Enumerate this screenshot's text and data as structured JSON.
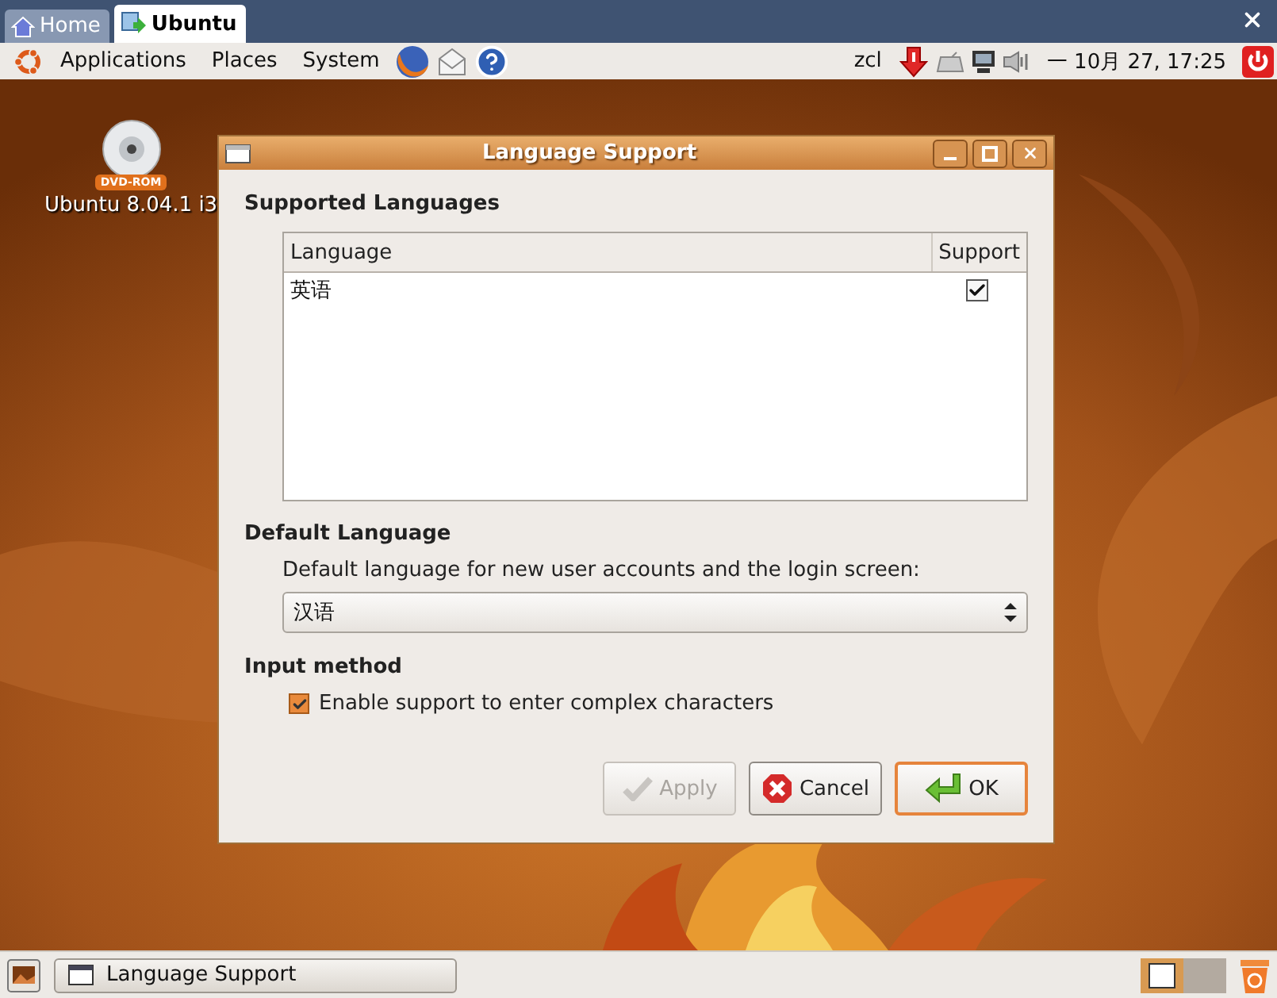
{
  "browser_tabs": [
    {
      "label": "Home",
      "selected": false
    },
    {
      "label": "Ubuntu",
      "selected": true
    }
  ],
  "top_panel": {
    "menus": [
      "Applications",
      "Places",
      "System"
    ],
    "user": "zcl",
    "clock": "一 10月 27, 17:25"
  },
  "desktop_icons": [
    {
      "label": "Ubuntu 8.04.1 i3",
      "badge": "DVD-ROM"
    }
  ],
  "dialog": {
    "title": "Language Support",
    "supported_languages": {
      "heading": "Supported Languages",
      "columns": [
        "Language",
        "Support"
      ],
      "rows": [
        {
          "language": "英语",
          "checked": true
        }
      ]
    },
    "default_language": {
      "heading": "Default Language",
      "description": "Default language for new user accounts and the login screen:",
      "value": "汉语"
    },
    "input_method": {
      "heading": "Input method",
      "label": "Enable support to enter complex characters",
      "checked": true
    },
    "buttons": [
      {
        "label": "Apply",
        "kind": "apply",
        "disabled": true,
        "focused": false
      },
      {
        "label": "Cancel",
        "kind": "cancel",
        "disabled": false,
        "focused": false
      },
      {
        "label": "OK",
        "kind": "ok",
        "disabled": false,
        "focused": true
      }
    ]
  },
  "bottom_panel": {
    "tasks": [
      {
        "label": "Language Support",
        "selected": false
      }
    ],
    "workspaces": [
      {
        "selected": true
      },
      {
        "selected": false
      }
    ]
  }
}
